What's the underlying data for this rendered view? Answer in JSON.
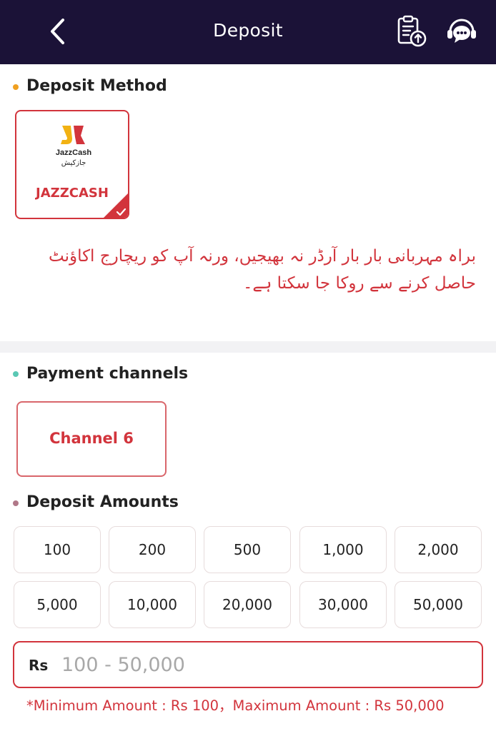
{
  "header": {
    "title": "Deposit",
    "back_icon": "chevron-left-icon",
    "records_icon": "clipboard-upload-icon",
    "support_icon": "headset-chat-icon",
    "background": "#1b1237"
  },
  "deposit_method": {
    "section_title": "Deposit Method",
    "dot_color": "#f0a020",
    "selected": {
      "logo_name": "JazzCash",
      "logo_urdu": "جازکیش",
      "label": "JAZZCASH",
      "selected_icon": "check-icon"
    }
  },
  "notice": {
    "text": "براہ مہربانی بار بار آرڈر نہ بھیجیں، ورنہ آپ کو ریچارج اکاؤنٹ حاصل کرنے سے روکا جا سکتا ہے۔"
  },
  "payment_channels": {
    "section_title": "Payment channels",
    "dot_color": "#5ac8b4",
    "channels": [
      {
        "label": "Channel 6"
      }
    ]
  },
  "deposit_amounts": {
    "section_title": "Deposit Amounts",
    "dot_color": "#b07888",
    "amounts": [
      "100",
      "200",
      "500",
      "1,000",
      "2,000",
      "5,000",
      "10,000",
      "20,000",
      "30,000",
      "50,000"
    ]
  },
  "amount_input": {
    "prefix": "Rs",
    "placeholder": "100 - 50,000",
    "value": ""
  },
  "limit_note": "*Minimum Amount : Rs 100，Maximum Amount : Rs 50,000",
  "colors": {
    "accent": "#d2343c",
    "header": "#1b1237"
  }
}
